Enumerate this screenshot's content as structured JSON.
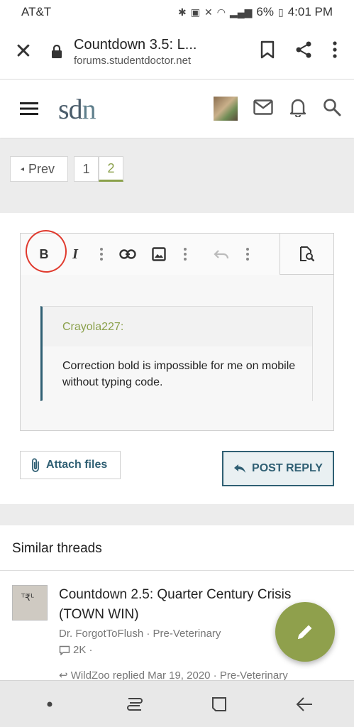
{
  "status_bar": {
    "carrier": "AT&T",
    "battery": "6%",
    "time": "4:01 PM"
  },
  "browser": {
    "page_title": "Countdown 3.5: L...",
    "url": "forums.studentdoctor.net"
  },
  "site": {
    "logo_text_1": "sd",
    "logo_text_2": "n"
  },
  "pagination": {
    "prev_label": "Prev",
    "pages": [
      "1",
      "2"
    ],
    "current_page": "2"
  },
  "editor": {
    "bold_label": "B",
    "italic_label": "I",
    "quote_author": "Crayola227:",
    "quote_text": "Correction bold is impossible for me on mobile without typing code."
  },
  "actions": {
    "attach_label": "Attach files",
    "post_label": "POST REPLY"
  },
  "similar_threads": {
    "heading": "Similar threads",
    "items": [
      {
        "title": "Countdown 2.5: Quarter Century Crisis (TOWN WIN)",
        "author": "Dr. ForgotToFlush",
        "forum": "Pre-Veterinary",
        "meta": "Dr. ForgotToFlush · Pre-Veterinary",
        "replies": "2K ·",
        "last_reply": "WildZoo replied Mar 19, 2020 · Pre-Veterinary"
      }
    ]
  },
  "colors": {
    "accent_green": "#8aa04a",
    "accent_teal": "#2f5f73",
    "annotation_red": "#e03a2e",
    "fab": "#8fa04c"
  },
  "icons": [
    "close-icon",
    "lock-icon",
    "bookmark-icon",
    "share-icon",
    "more-vert-icon",
    "menu-icon",
    "mail-icon",
    "bell-icon",
    "search-icon",
    "link-icon",
    "image-icon",
    "undo-icon",
    "preview-icon",
    "paperclip-icon",
    "reply-arrow-icon",
    "pencil-icon",
    "comment-icon"
  ]
}
